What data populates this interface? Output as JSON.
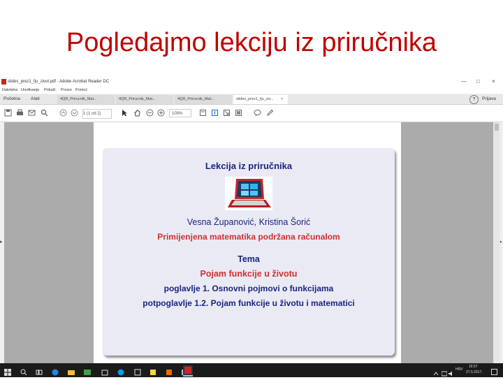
{
  "slide": {
    "title": "Pogledajmo lekciju iz priručnika"
  },
  "window": {
    "title": "slides_prez1_fju_zivot.pdf - Adobe Acrobat Reader DC",
    "minimize": "—",
    "maximize": "□",
    "close": "×"
  },
  "menu": [
    "Datoteka",
    "Uređivanje",
    "Prikaži",
    "Prozor",
    "Pomoć"
  ],
  "tabs": {
    "home": "Početna",
    "tools": "Alati",
    "documents": [
      {
        "label": "4QR_Prirucnik_Mat..."
      },
      {
        "label": "4QR_Prirucnik_Mat..."
      },
      {
        "label": "4QR_Prirucnik_Mat..."
      },
      {
        "label": "slides_prez1_fju_ziv...",
        "close": "×"
      }
    ],
    "help": "?",
    "signin": "Prijava"
  },
  "toolbar": {
    "page_indicator": "1 (1 od 2)",
    "zoom": "109%"
  },
  "document": {
    "title": "Lekcija iz priručnika",
    "authors": "Vesna Županović, Kristina Šorić",
    "subject": "Primijenjena matematika podržana računalom",
    "tema_label": "Tema",
    "topic": "Pojam funkcije u životu",
    "chapter": "poglavlje 1.  Osnovni pojmovi o funkcijama",
    "subchapter": "potpoglavlje 1.2.  Pojam funkcije u životu i matematici"
  },
  "taskbar": {
    "language": "HRV",
    "time": "16:57",
    "date": "27.5.2017."
  },
  "colors": {
    "title_red": "#c00000",
    "slide_blue": "#1a237e",
    "slide_red": "#d32f2f",
    "acrobat_red": "#c62828"
  }
}
